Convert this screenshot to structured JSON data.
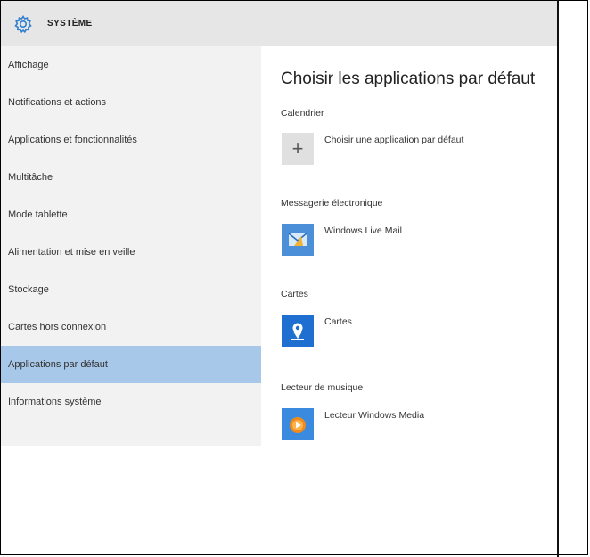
{
  "header": {
    "title": "SYSTÈME",
    "icon": "gear-icon"
  },
  "sidebar": {
    "items": [
      {
        "label": "Affichage",
        "active": false
      },
      {
        "label": "Notifications et actions",
        "active": false
      },
      {
        "label": "Applications et fonctionnalités",
        "active": false
      },
      {
        "label": "Multitâche",
        "active": false
      },
      {
        "label": "Mode tablette",
        "active": false
      },
      {
        "label": "Alimentation et mise en veille",
        "active": false
      },
      {
        "label": "Stockage",
        "active": false
      },
      {
        "label": "Cartes hors connexion",
        "active": false
      },
      {
        "label": "Applications par défaut",
        "active": true
      },
      {
        "label": "Informations système",
        "active": false
      }
    ]
  },
  "main": {
    "title": "Choisir les applications par défaut",
    "sections": [
      {
        "label": "Calendrier",
        "app": "Choisir une application par défaut",
        "icon": "plus-icon"
      },
      {
        "label": "Messagerie électronique",
        "app": "Windows Live Mail",
        "icon": "windows-live-mail-icon"
      },
      {
        "label": "Cartes",
        "app": "Cartes",
        "icon": "maps-icon"
      },
      {
        "label": "Lecteur de musique",
        "app": "Lecteur Windows Media",
        "icon": "windows-media-player-icon"
      }
    ]
  },
  "colors": {
    "header_bg": "#e6e6e6",
    "sidebar_bg": "#f2f2f2",
    "active_item_bg": "#a8c8ea",
    "accent": "#2f7fd0"
  }
}
